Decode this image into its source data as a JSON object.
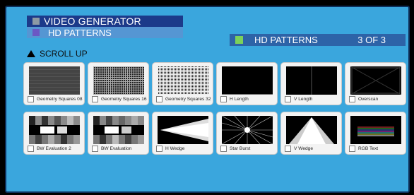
{
  "header": {
    "title": "VIDEO GENERATOR",
    "subtitle": "HD PATTERNS"
  },
  "section": {
    "title": "HD PATTERNS",
    "counter": "3 OF 3"
  },
  "scroll": {
    "label": "SCROLL UP"
  },
  "tiles": [
    {
      "label": "Geometry Squares 08"
    },
    {
      "label": "Geometry Squares 16"
    },
    {
      "label": "Geometry Squares 32"
    },
    {
      "label": "H Length"
    },
    {
      "label": "V Length"
    },
    {
      "label": "Overscan"
    },
    {
      "label": "BW Evaluation 2"
    },
    {
      "label": "BW Evaluation"
    },
    {
      "label": "H Wedge"
    },
    {
      "label": "Star Burst"
    },
    {
      "label": "V Wedge"
    },
    {
      "label": "RGB Text"
    }
  ],
  "colors": {
    "panel": "#3aa6dd",
    "title_bar": "#1c3a8a",
    "subtitle_bar": "#5596d3",
    "section_bar": "#2d63a7",
    "accent_green": "#7cd15a",
    "accent_purple": "#6b57c4"
  }
}
